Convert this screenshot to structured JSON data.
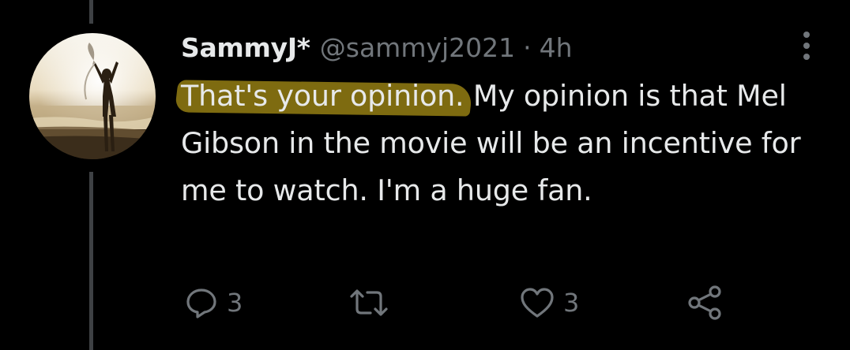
{
  "tweet": {
    "display_name": "SammyJ*",
    "handle": "@sammyj2021",
    "separator": "·",
    "time": "4h",
    "text_highlighted": "That's your opinion.",
    "text_rest": " My opinion is that Mel Gibson in the movie will be an incentive for me to watch. I'm a huge fan.",
    "highlight_color": "#8f7a12"
  },
  "actions": {
    "reply_count": "3",
    "retweet_count": "",
    "like_count": "3"
  },
  "icons": {
    "reply": "reply-icon",
    "retweet": "retweet-icon",
    "like": "heart-icon",
    "share": "share-icon",
    "more": "more-icon"
  },
  "colors": {
    "background": "#000000",
    "text": "#e7e9ea",
    "secondary": "#71767b",
    "thread_line": "#3e4144"
  }
}
